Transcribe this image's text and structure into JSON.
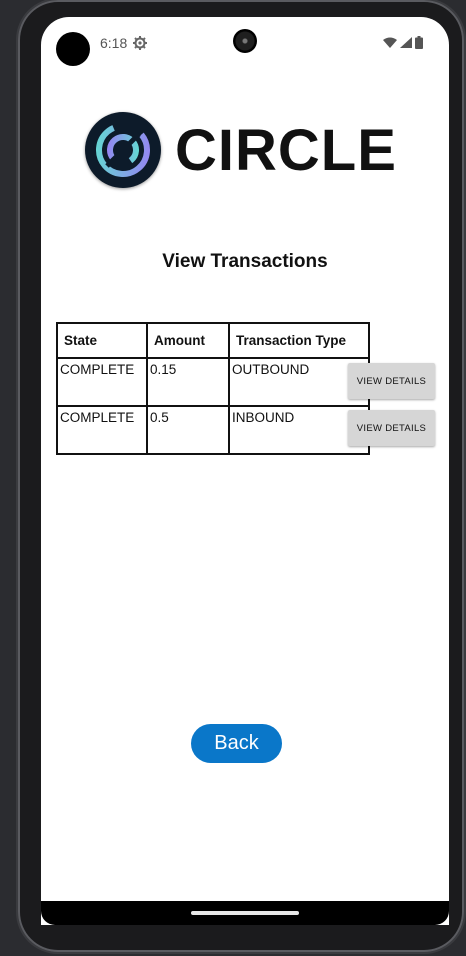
{
  "status_bar": {
    "time": "6:18"
  },
  "brand": {
    "name": "CIRCLE"
  },
  "page": {
    "title": "View Transactions"
  },
  "table": {
    "headers": [
      "State",
      "Amount",
      "Transaction Type"
    ],
    "rows": [
      {
        "state": "COMPLETE",
        "amount": "0.15",
        "type": "OUTBOUND",
        "action": "VIEW DETAILS"
      },
      {
        "state": "COMPLETE",
        "amount": "0.5",
        "type": "INBOUND",
        "action": "VIEW DETAILS"
      }
    ]
  },
  "back_button": {
    "label": "Back"
  },
  "colors": {
    "primary": "#0a77c9",
    "details_button": "#d6d6d6"
  },
  "icons": [
    "gear-icon",
    "wifi-icon",
    "signal-icon",
    "battery-icon",
    "circle-logo-icon"
  ]
}
